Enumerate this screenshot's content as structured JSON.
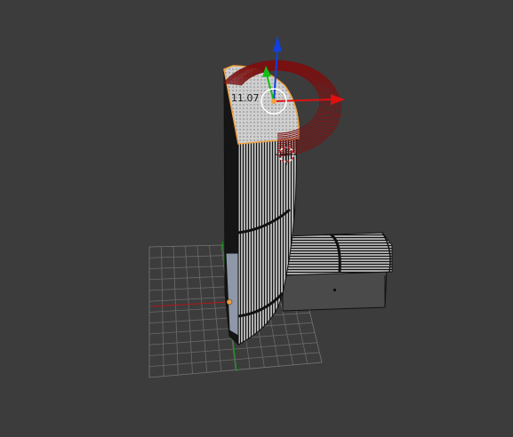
{
  "viewport": {
    "dimension_readout": "11.07",
    "colors": {
      "background": "#3c3c3c",
      "grid": "#6a6a6a",
      "mesh_dark": "#101010",
      "mesh_light": "#9a9a9a",
      "selection": "#f0a040",
      "axis_x": "#e01010",
      "axis_y": "#10c010",
      "axis_z": "#1040e0",
      "rotation_ring": "#7a1010"
    },
    "icons": {
      "transform_gizmo": "move-gizmo-icon",
      "cursor": "3d-cursor-icon",
      "origin": "object-origin-icon"
    }
  }
}
